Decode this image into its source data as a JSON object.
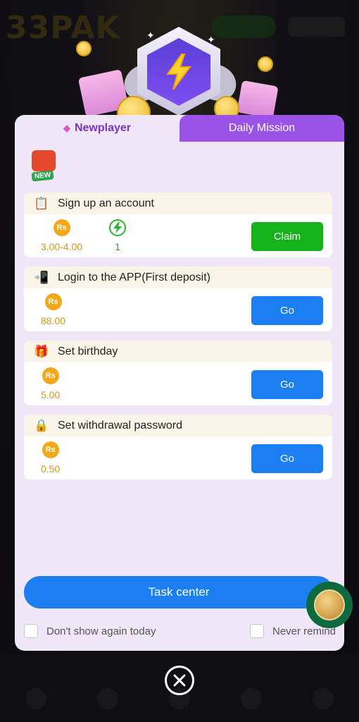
{
  "background": {
    "logo": "33PAK"
  },
  "tabs": [
    {
      "label": "Newplayer",
      "active": true
    },
    {
      "label": "Daily Mission",
      "active": false
    }
  ],
  "new_badge": "NEW",
  "tasks": [
    {
      "title": "Sign up an account",
      "icon": "clipboard-icon",
      "rewards": [
        {
          "type": "rs",
          "symbol": "Rs",
          "value": "3.00-4.00"
        },
        {
          "type": "energy",
          "value": "1"
        }
      ],
      "action": "Claim"
    },
    {
      "title": "Login to the APP(First deposit)",
      "icon": "phone-login-icon",
      "rewards": [
        {
          "type": "rs",
          "symbol": "Rs",
          "value": "88.00"
        }
      ],
      "action": "Go"
    },
    {
      "title": "Set birthday",
      "icon": "gift-icon",
      "rewards": [
        {
          "type": "rs",
          "symbol": "Rs",
          "value": "5.00"
        }
      ],
      "action": "Go"
    },
    {
      "title": "Set withdrawal password",
      "icon": "lock-icon",
      "rewards": [
        {
          "type": "rs",
          "symbol": "Rs",
          "value": "0.50"
        }
      ],
      "action": "Go"
    }
  ],
  "task_center": "Task center",
  "checkboxes": {
    "dont_show": "Don't show again today",
    "never_remind": "Never remind"
  },
  "colors": {
    "accent_purple": "#9a53e6",
    "claim_green": "#14b21b",
    "go_blue": "#1b7ff2",
    "reward_gold": "#f2a818"
  }
}
